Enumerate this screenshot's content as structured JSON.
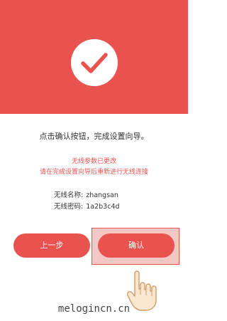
{
  "colors": {
    "accent": "#e8524f",
    "highlight": "#f3c7c4"
  },
  "icons": {
    "success": "checkmark-circle-icon",
    "pointer": "pointing-hand-icon"
  },
  "instruction": "点击确认按钮，完成设置向导。",
  "notice": {
    "line1": "无线参数已更改",
    "line2": "请在完成设置向导后重新进行无线连接"
  },
  "credentials": {
    "ssid_label": "无线名称:",
    "ssid_value": "zhangsan",
    "password_label": "无线密码:",
    "password_value": "1a2b3c4d"
  },
  "buttons": {
    "prev_label": "上一步",
    "confirm_label": "确认"
  },
  "watermark": "melogincn.cn"
}
